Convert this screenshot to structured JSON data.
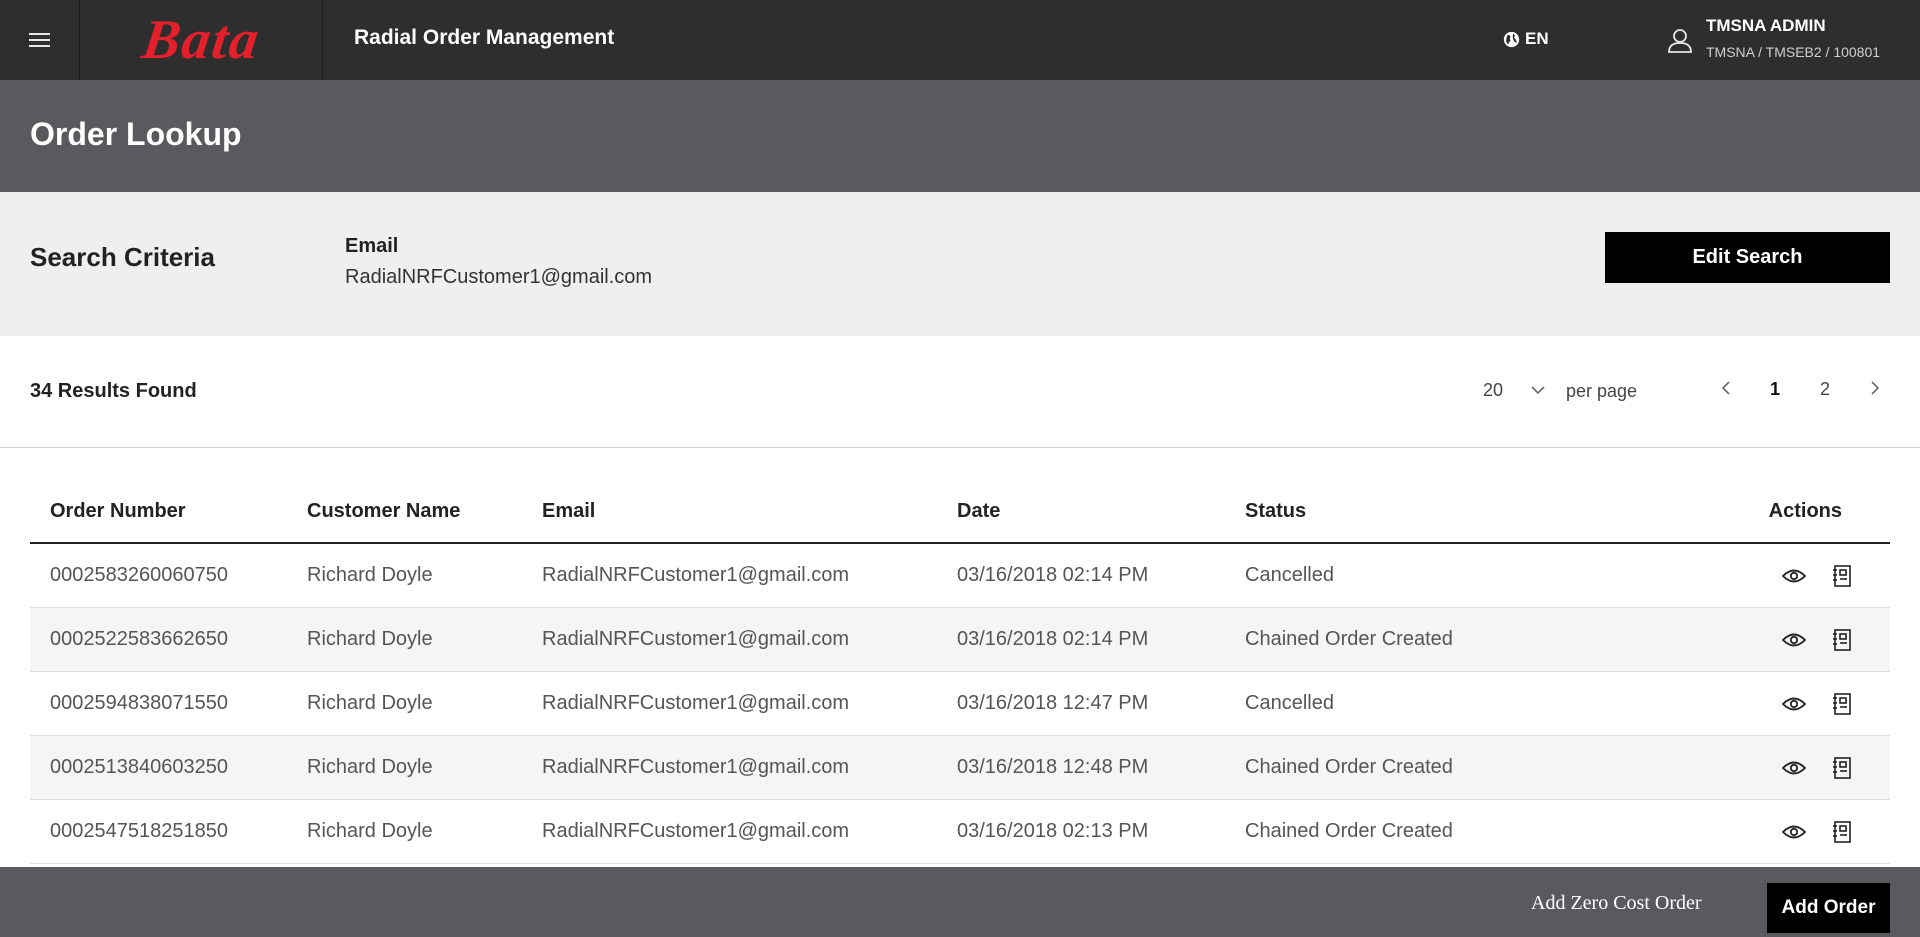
{
  "header": {
    "logo_text": "Bata",
    "app_title": "Radial Order Management",
    "language": "EN",
    "user_name": "TMSNA ADMIN",
    "user_context": "TMSNA / TMSEB2 / 100801"
  },
  "page_title": "Order Lookup",
  "criteria": {
    "title": "Search Criteria",
    "field_label": "Email",
    "field_value": "RadialNRFCustomer1@gmail.com",
    "edit_label": "Edit Search"
  },
  "results": {
    "count_label": "34 Results Found",
    "per_page_value": "20",
    "per_page_label": "per page",
    "pages": [
      "1",
      "2"
    ],
    "current_page": "1"
  },
  "table": {
    "headers": [
      "Order Number",
      "Customer Name",
      "Email",
      "Date",
      "Status",
      "Actions"
    ],
    "rows": [
      {
        "order": "0002583260060750",
        "customer": "Richard Doyle",
        "email": "RadialNRFCustomer1@gmail.com",
        "date": "03/16/2018 02:14 PM",
        "status": "Cancelled"
      },
      {
        "order": "0002522583662650",
        "customer": "Richard Doyle",
        "email": "RadialNRFCustomer1@gmail.com",
        "date": "03/16/2018 02:14 PM",
        "status": "Chained Order Created"
      },
      {
        "order": "0002594838071550",
        "customer": "Richard Doyle",
        "email": "RadialNRFCustomer1@gmail.com",
        "date": "03/16/2018 12:47 PM",
        "status": "Cancelled"
      },
      {
        "order": "0002513840603250",
        "customer": "Richard Doyle",
        "email": "RadialNRFCustomer1@gmail.com",
        "date": "03/16/2018 12:48 PM",
        "status": "Chained Order Created"
      },
      {
        "order": "0002547518251850",
        "customer": "Richard Doyle",
        "email": "RadialNRFCustomer1@gmail.com",
        "date": "03/16/2018 02:13 PM",
        "status": "Chained Order Created"
      }
    ],
    "row_actions": [
      "eye-icon",
      "receipt-icon"
    ]
  },
  "footer": {
    "zero_cost_label": "Add Zero Cost Order",
    "add_order_label": "Add Order"
  },
  "colors": {
    "topbar": "#2e2e2e",
    "header_band": "#5a5a5e",
    "criteria_band": "#efefef",
    "brand_red": "#e3202b",
    "button_black": "#000000"
  }
}
